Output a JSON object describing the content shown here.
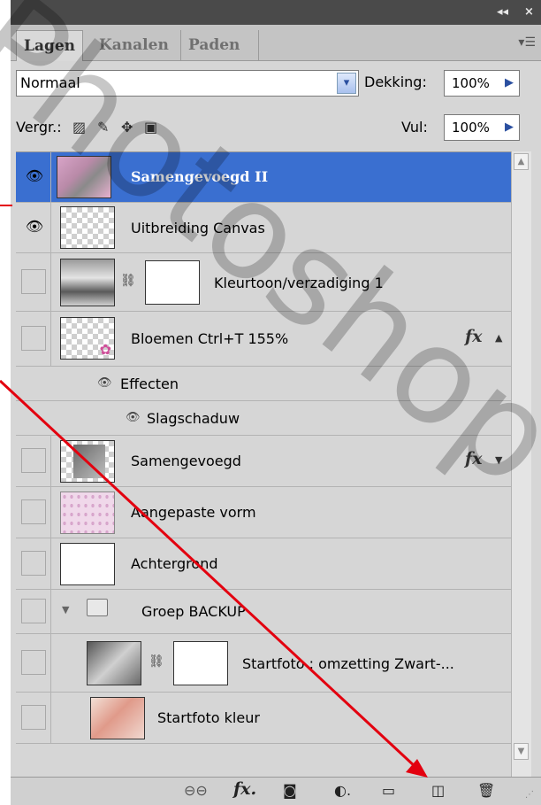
{
  "tabs": [
    {
      "label": "Lagen",
      "active": true
    },
    {
      "label": "Kanalen",
      "active": false
    },
    {
      "label": "Paden",
      "active": false
    }
  ],
  "titlebar": {
    "collapse_label": "◂◂",
    "close_label": "×"
  },
  "blend": {
    "mode": "Normaal",
    "opacity_label": "Dekking:",
    "opacity_value": "100%"
  },
  "lock": {
    "label": "Vergr.:",
    "fill_label": "Vul:",
    "fill_value": "100%"
  },
  "layers": [
    {
      "name": "Samengevoegd II",
      "visible": true,
      "selected": true
    },
    {
      "name": "Uitbreiding Canvas",
      "visible": true
    },
    {
      "name": "Kleurtoon/verzadiging 1",
      "visible": false
    },
    {
      "name": "Bloemen Ctrl+T 155%",
      "visible": false,
      "fx": "fx"
    },
    {
      "name": "Samengevoegd",
      "visible": false,
      "fx": "fx"
    },
    {
      "name": "Aangepaste vorm",
      "visible": false
    },
    {
      "name": "Achtergrond",
      "visible": false
    },
    {
      "name": "Groep BACKUP",
      "visible": false
    },
    {
      "name": "Startfoto : omzetting Zwart-...",
      "visible": false
    },
    {
      "name": "Startfoto kleur",
      "visible": false
    }
  ],
  "effects": {
    "header": "Effecten",
    "item": "Slagschaduw"
  },
  "watermark": {
    "text": "Photoshop©"
  },
  "colors": {
    "selected": "#3a6fd0",
    "arrow": "#e3000f",
    "panel": "#d6d6d6"
  }
}
